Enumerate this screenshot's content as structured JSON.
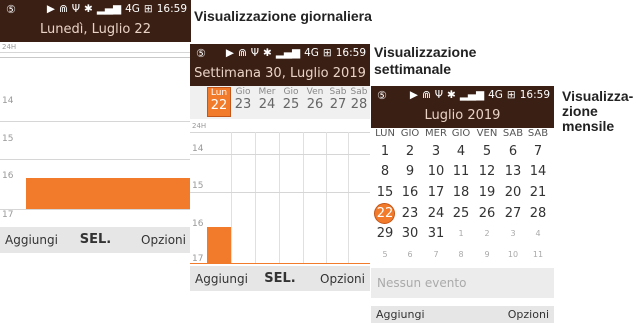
{
  "status": {
    "left_icon": "⑤",
    "icons": [
      "▶",
      "⋒",
      "Ψ",
      "✱",
      "▂▄▆",
      "4G",
      "⊞"
    ],
    "time": "16:59"
  },
  "captions": {
    "daily": "Visualizzazione giornaliera",
    "weekly_1": "Visualizzazione",
    "weekly_2": "settimanale",
    "monthly_1": "Visualizza-",
    "monthly_2": "zione",
    "monthly_3": "mensile"
  },
  "daily": {
    "title": "Lunedì, Luglio 22",
    "allday_label": "24H",
    "hours": [
      "14",
      "15",
      "16",
      "17"
    ],
    "softkeys": {
      "left": "Aggiungi",
      "center": "SEL.",
      "right": "Opzioni"
    }
  },
  "weekly": {
    "title": "Settimana 30, Luglio 2019",
    "allday_label": "24H",
    "days": [
      {
        "name": "Lun",
        "date": "22",
        "selected": true
      },
      {
        "name": "Gio",
        "date": "23"
      },
      {
        "name": "Mer",
        "date": "24"
      },
      {
        "name": "Gio",
        "date": "25"
      },
      {
        "name": "Ven",
        "date": "26"
      },
      {
        "name": "Sab",
        "date": "27"
      },
      {
        "name": "Sab",
        "date": "28"
      }
    ],
    "hours": [
      "14",
      "15",
      "16",
      "17"
    ],
    "softkeys": {
      "left": "Aggiungi",
      "center": "SEL.",
      "right": "Opzioni"
    }
  },
  "monthly": {
    "title": "Luglio 2019",
    "weekday_headers": [
      "LUN",
      "GIO",
      "MER",
      "GIO",
      "VEN",
      "SAB",
      "SAB"
    ],
    "weeks": [
      [
        "1",
        "2",
        "3",
        "4",
        "5",
        "6",
        "7"
      ],
      [
        "8",
        "9",
        "10",
        "11",
        "12",
        "13",
        "14"
      ],
      [
        "15",
        "16",
        "17",
        "18",
        "19",
        "20",
        "21"
      ],
      [
        "22",
        "23",
        "24",
        "25",
        "26",
        "27",
        "28"
      ],
      [
        "29",
        "30",
        "31",
        "1",
        "2",
        "3",
        "4"
      ],
      [
        "5",
        "6",
        "7",
        "8",
        "9",
        "10",
        "11"
      ]
    ],
    "today": "22",
    "no_events": "Nessun evento",
    "softkeys": {
      "left": "Aggiungi",
      "right": "Opzioni"
    }
  },
  "colors": {
    "accent": "#f27b2b",
    "header": "#3a1f14"
  }
}
